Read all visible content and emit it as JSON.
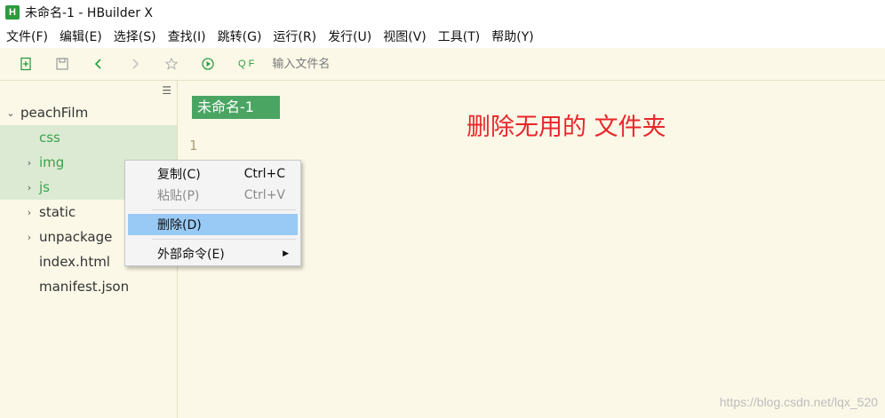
{
  "window": {
    "title": "未命名-1 - HBuilder X",
    "logo": "H"
  },
  "menubar": {
    "items": [
      "文件(F)",
      "编辑(E)",
      "选择(S)",
      "查找(I)",
      "跳转(G)",
      "运行(R)",
      "发行(U)",
      "视图(V)",
      "工具(T)",
      "帮助(Y)"
    ]
  },
  "toolbar": {
    "search_icon": "Q F",
    "search_placeholder": "输入文件名"
  },
  "sidebar": {
    "tree": [
      {
        "label": "peachFilm",
        "expanded": true
      },
      {
        "label": "css"
      },
      {
        "label": "img"
      },
      {
        "label": "js"
      },
      {
        "label": "static"
      },
      {
        "label": "unpackage"
      },
      {
        "label": "index.html"
      },
      {
        "label": "manifest.json"
      }
    ]
  },
  "editor": {
    "tab_label": "未命名-1",
    "line_number": "1",
    "annotation": "删除无用的 文件夹"
  },
  "context_menu": {
    "copy": {
      "label": "复制(C)",
      "shortcut": "Ctrl+C"
    },
    "paste": {
      "label": "粘贴(P)",
      "shortcut": "Ctrl+V"
    },
    "delete": {
      "label": "删除(D)"
    },
    "external": {
      "label": "外部命令(E)"
    }
  },
  "watermark": "https://blog.csdn.net/lqx_520",
  "colors": {
    "accent_green": "#4aa563",
    "selection_bg": "#dcead3",
    "menu_highlight": "#99c9f5",
    "annotation_red": "#e8262b",
    "editor_bg": "#fbf8e7"
  }
}
